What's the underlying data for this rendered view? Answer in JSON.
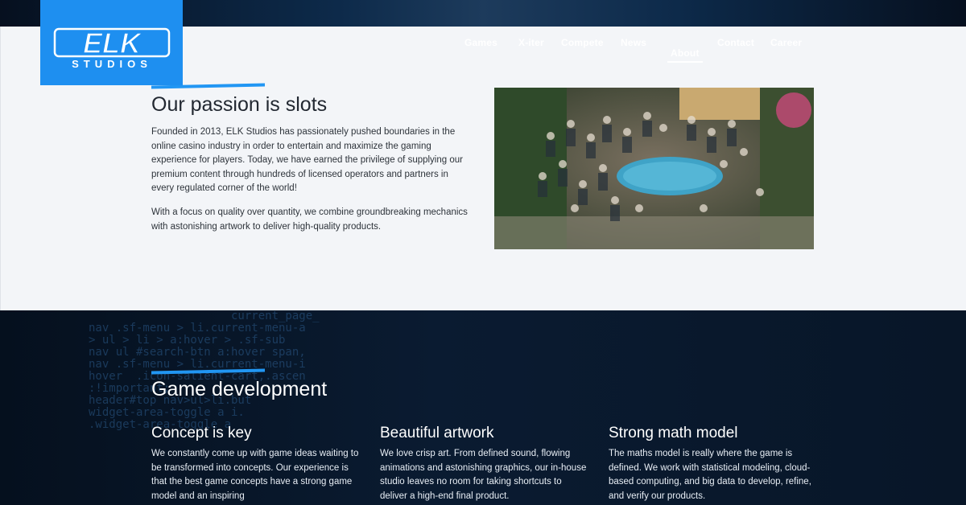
{
  "logo": {
    "top": "ELK",
    "bottom": "STUDIOS"
  },
  "nav": {
    "items": [
      "Games",
      "X-iter",
      "Compete",
      "News",
      "About",
      "Contact",
      "Career"
    ],
    "active": "About"
  },
  "about": {
    "title": "Our passion is slots",
    "paragraph1": "Founded in 2013, ELK Studios has passionately pushed boundaries in the online casino industry in order to entertain and maximize the gaming experience for players. Today, we have earned the privilege of supplying our premium content through hundreds of licensed operators and partners in every regulated corner of the world!",
    "paragraph2": "With a focus on quality over quantity, we combine groundbreaking mechanics with astonishing artwork to deliver high-quality products."
  },
  "game_dev": {
    "title": "Game development",
    "columns": [
      {
        "title": "Concept is key",
        "text": "We constantly come up with game ideas waiting to be transformed into concepts. Our experience is that the best game concepts have a strong game model and an inspiring"
      },
      {
        "title": "Beautiful artwork",
        "text": "We love crisp art. From defined sound, flowing animations and astonishing graphics, our in-house studio leaves no room for taking shortcuts to deliver a high-end final product."
      },
      {
        "title": "Strong math model",
        "text": "The maths model is really where the game is defined. We work with statistical modeling, cloud-based computing, and big data to develop, refine, and verify our products."
      }
    ]
  },
  "code_background": {
    "lines": [
      "                     current_page_",
      "nav .sf-menu > li.current-menu-a",
      "> ul > li > a:hover > .sf-sub",
      "nav ul #search-btn a:hover span,",
      "nav .sf-menu > li.current-menu-i",
      "hover  .icon-salient-cart,.ascen",
      ":!important;",
      "header#top nav>ul>li.but",
      "widget-area-toggle a i.",
      ".widget-area-toggle a"
    ]
  },
  "colors": {
    "accent": "#2196f3",
    "logo_bg": "#1e8ff0",
    "light_bg": "#f3f5f8",
    "dark_bg": "#0a1b31"
  }
}
